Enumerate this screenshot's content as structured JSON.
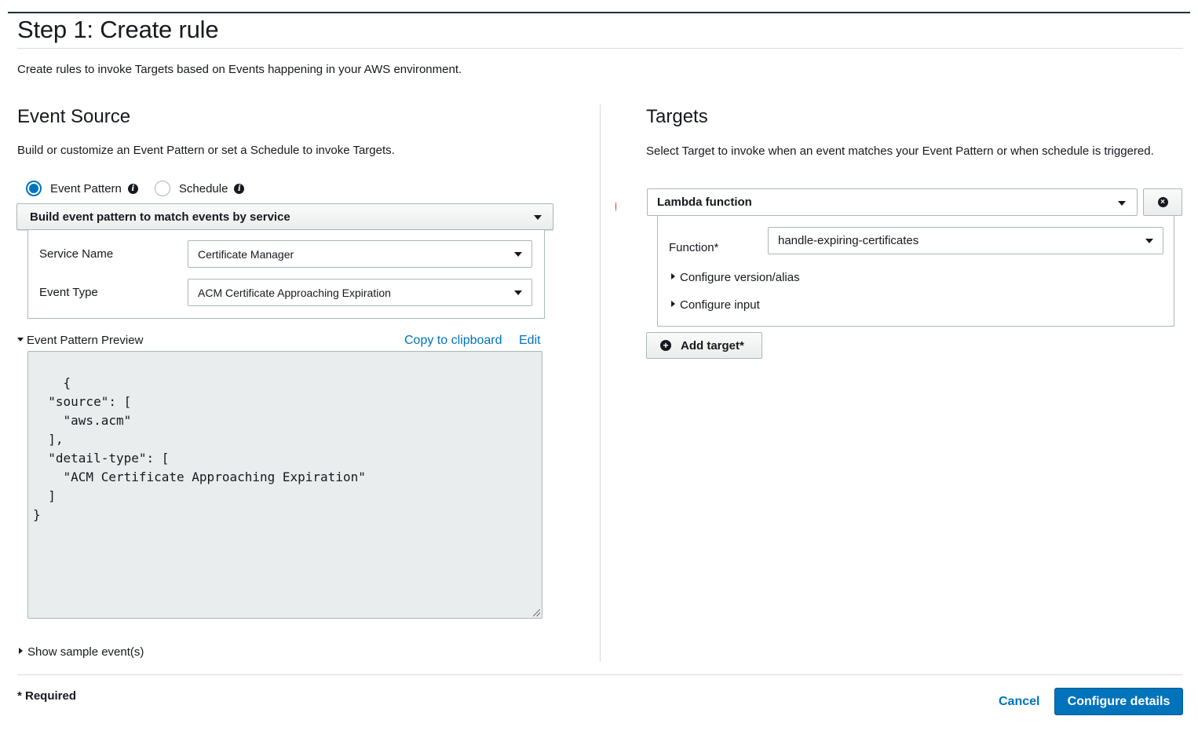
{
  "page": {
    "title": "Step 1: Create rule",
    "description": "Create rules to invoke Targets based on Events happening in your AWS environment."
  },
  "event_source": {
    "title": "Event Source",
    "description": "Build or customize an Event Pattern or set a Schedule to invoke Targets.",
    "radio_options": [
      {
        "label": "Event Pattern",
        "selected": true
      },
      {
        "label": "Schedule",
        "selected": false
      }
    ],
    "pattern_mode": "Build event pattern to match events by service",
    "service_name_label": "Service Name",
    "service_name_value": "Certificate Manager",
    "event_type_label": "Event Type",
    "event_type_value": "ACM Certificate Approaching Expiration",
    "preview_label": "Event Pattern Preview",
    "copy_label": "Copy to clipboard",
    "edit_label": "Edit",
    "preview_code": "{\n  \"source\": [\n    \"aws.acm\"\n  ],\n  \"detail-type\": [\n    \"ACM Certificate Approaching Expiration\"\n  ]\n}",
    "show_sample_label": "Show sample event(s)"
  },
  "targets": {
    "title": "Targets",
    "description": "Select Target to invoke when an event matches your Event Pattern or when schedule is triggered.",
    "target_type": "Lambda function",
    "function_label": "Function*",
    "function_value": "handle-expiring-certificates",
    "configure_version_label": "Configure version/alias",
    "configure_input_label": "Configure input",
    "add_target_label": "Add target*"
  },
  "footer": {
    "required_note": "* Required",
    "cancel_label": "Cancel",
    "configure_details_label": "Configure details"
  },
  "colors": {
    "accent": "#0073bb",
    "text": "#16191f",
    "border": "#aab7b8",
    "code_bg": "#eaeded"
  },
  "icons": {
    "info": "info-icon",
    "dropdown": "chevron-down-icon",
    "remove": "close-circle-icon",
    "add": "plus-circle-icon"
  }
}
